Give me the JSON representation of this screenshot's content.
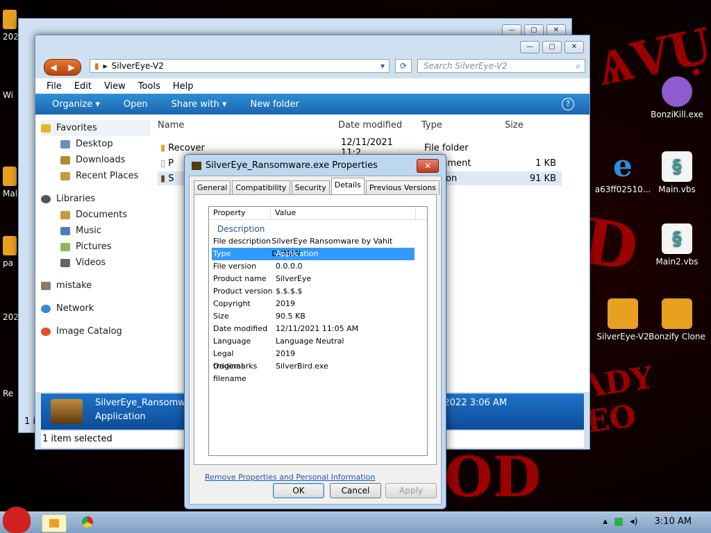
{
  "desktop": {
    "left_labels": [
      "202",
      "Wi",
      "Mal",
      "pa",
      "202",
      "Re"
    ],
    "icons": [
      {
        "label": "BonziKill.exe",
        "icon": "purple-gorilla-icon",
        "color": "#8e5bd1"
      },
      {
        "label": "a63ff02510...",
        "icon": "internet-explorer-icon",
        "color": "#2d8de0"
      },
      {
        "label": "Main.vbs",
        "icon": "script-icon",
        "color": "#3aa0a0"
      },
      {
        "label": "Main2.vbs",
        "icon": "script-icon",
        "color": "#3aa0a0"
      },
      {
        "label": "SilverEye-V2",
        "icon": "folder-icon",
        "color": "#e8a020"
      },
      {
        "label": "Bonzify Clone",
        "icon": "folder-icon",
        "color": "#e8a020"
      }
    ]
  },
  "explorer": {
    "address": "SilverEye-V2",
    "search_placeholder": "Search SilverEye-V2",
    "menu": [
      "File",
      "Edit",
      "View",
      "Tools",
      "Help"
    ],
    "commands": [
      "Organize ▾",
      "Open",
      "Share with ▾",
      "New folder"
    ],
    "nav": [
      "Favorites",
      "Desktop",
      "Downloads",
      "Recent Places",
      "Libraries",
      "Documents",
      "Music",
      "Pictures",
      "Videos",
      "mistake",
      "Network",
      "Image Catalog"
    ],
    "columns": [
      "Name",
      "Date modified",
      "Type",
      "Size"
    ],
    "rows": [
      {
        "name": "Recover",
        "date": "12/11/2021 11:2...",
        "type": "File folder",
        "size": ""
      },
      {
        "name": "P",
        "date": "",
        "type": "Document",
        "size": "1 KB"
      },
      {
        "name": "S",
        "date": "",
        "type": "lication",
        "size": "91 KB"
      }
    ],
    "details_name": "SilverEye_Ransomware",
    "details_type": "Application",
    "details_date": "/2022 3:06 AM",
    "status": "1 item selected",
    "back_status": "1 it"
  },
  "dialog": {
    "title": "SilverEye_Ransomware.exe Properties",
    "tabs": [
      "General",
      "Compatibility",
      "Security",
      "Details",
      "Previous Versions"
    ],
    "header_property": "Property",
    "header_value": "Value",
    "section": "Description",
    "props": [
      {
        "k": "File description",
        "v": "SilverEye Ransomware by Vahit DUMAN"
      },
      {
        "k": "Type",
        "v": "Application"
      },
      {
        "k": "File version",
        "v": "0.0.0.0"
      },
      {
        "k": "Product name",
        "v": "SilverEye"
      },
      {
        "k": "Product version",
        "v": "$.$.$.$"
      },
      {
        "k": "Copyright",
        "v": "2019"
      },
      {
        "k": "Size",
        "v": "90.5 KB"
      },
      {
        "k": "Date modified",
        "v": "12/11/2021 11:05 AM"
      },
      {
        "k": "Language",
        "v": "Language Neutral"
      },
      {
        "k": "Legal trademarks",
        "v": "2019"
      },
      {
        "k": "Original filename",
        "v": "SilverBird.exe"
      }
    ],
    "remove_link": "Remove Properties and Personal Information",
    "ok": "OK",
    "cancel": "Cancel",
    "apply": "Apply"
  },
  "taskbar": {
    "clock": "3:10 AM"
  }
}
